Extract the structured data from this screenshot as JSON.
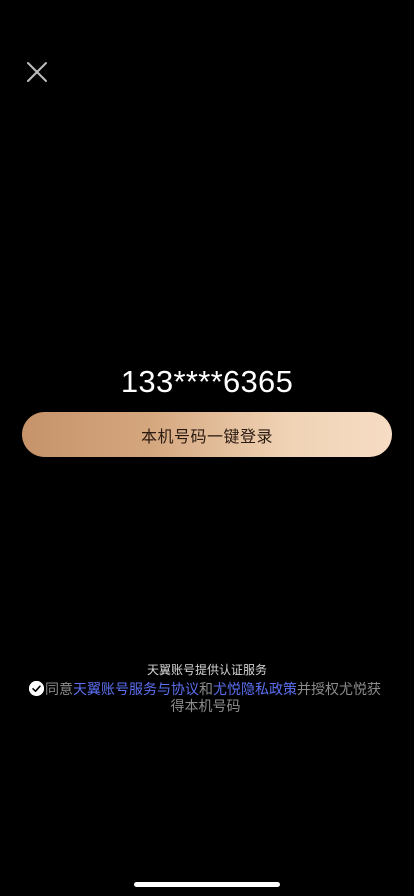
{
  "header": {
    "close_icon": "close-icon"
  },
  "login": {
    "masked_phone": "133****6365",
    "button_label": "本机号码一键登录",
    "button_colors": [
      "#c6936a",
      "#f6dcc4"
    ]
  },
  "footer": {
    "provider_text": "天翼账号提供认证服务",
    "agreement": {
      "checked": true,
      "check_icon": "check-circle-icon",
      "prefix": "同意",
      "link1": "天翼账号服务与协议",
      "connector": "和",
      "link2": "尤悦隐私政策",
      "suffix_line1": "并授权尤悦获",
      "suffix_line2": "得本机号码",
      "link_color": "#5b6ff0"
    }
  }
}
